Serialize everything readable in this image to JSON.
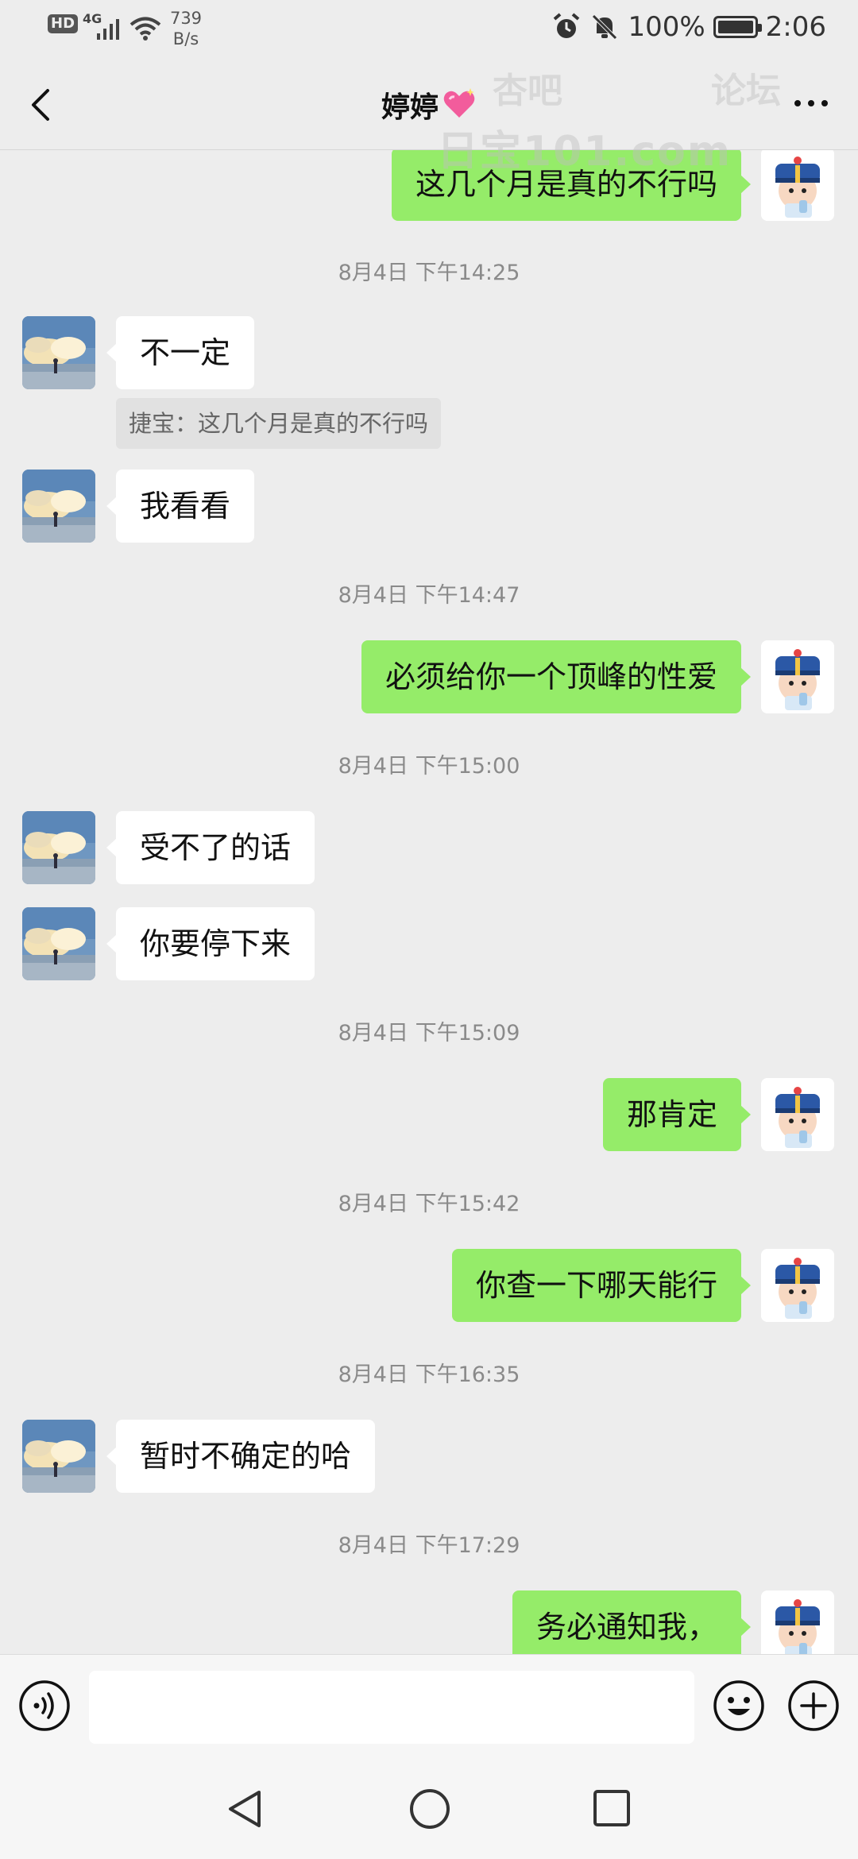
{
  "status_bar": {
    "hd_badge": "HD",
    "network": "4G",
    "net_speed_value": "739",
    "net_speed_unit": "B/s",
    "battery": "100%",
    "time": "2:06",
    "icons": [
      "signal-icon",
      "wifi-icon",
      "alarm-icon",
      "mute-icon",
      "battery-icon"
    ]
  },
  "header": {
    "title": "婷婷",
    "title_emoji": "sparkling-heart-icon",
    "icons": [
      "back-arrow-icon",
      "more-icon"
    ]
  },
  "watermark": {
    "line1_left": "杏吧",
    "line1_right": "论坛",
    "line2": "日宝101.com"
  },
  "messages": [
    {
      "type": "text",
      "side": "right",
      "text": "这几个月是真的不行吗"
    },
    {
      "type": "time",
      "text": "8月4日 下午14:25"
    },
    {
      "type": "text",
      "side": "left",
      "text": "不一定"
    },
    {
      "type": "quote",
      "text": "捷宝：这几个月是真的不行吗"
    },
    {
      "type": "text",
      "side": "left",
      "text": "我看看"
    },
    {
      "type": "time",
      "text": "8月4日 下午14:47"
    },
    {
      "type": "text",
      "side": "right",
      "text": "必须给你一个顶峰的性爱"
    },
    {
      "type": "time",
      "text": "8月4日 下午15:00"
    },
    {
      "type": "text",
      "side": "left",
      "text": "受不了的话"
    },
    {
      "type": "text",
      "side": "left",
      "text": "你要停下来"
    },
    {
      "type": "time",
      "text": "8月4日 下午15:09"
    },
    {
      "type": "text",
      "side": "right",
      "text": "那肯定"
    },
    {
      "type": "time",
      "text": "8月4日 下午15:42"
    },
    {
      "type": "text",
      "side": "right",
      "text": "你查一下哪天能行"
    },
    {
      "type": "time",
      "text": "8月4日 下午16:35"
    },
    {
      "type": "text",
      "side": "left",
      "text": "暂时不确定的哈"
    },
    {
      "type": "time",
      "text": "8月4日 下午17:29"
    },
    {
      "type": "text",
      "side": "right",
      "text": "务必通知我，"
    }
  ],
  "input_bar": {
    "value": "",
    "placeholder": "",
    "icons": [
      "voice-icon",
      "emoji-icon",
      "plus-icon"
    ]
  },
  "system_nav": {
    "icons": [
      "nav-back-icon",
      "nav-home-icon",
      "nav-recent-icon"
    ]
  },
  "colors": {
    "background": "#ededed",
    "sent_bubble": "#95ec69",
    "received_bubble": "#ffffff",
    "timestamp_text": "#8a8a8a",
    "quote_background": "#e1e1e1",
    "input_bar": "#f6f6f6"
  }
}
